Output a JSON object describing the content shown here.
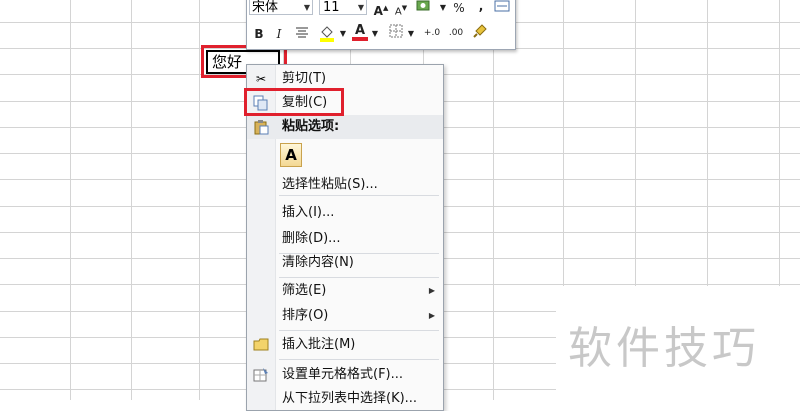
{
  "mini_toolbar": {
    "font_name": "宋体",
    "font_size": "11",
    "grow_font_glyph": "A",
    "shrink_font_glyph": "A",
    "percent_glyph": "%",
    "comma_glyph": ",",
    "bold_glyph": "B",
    "italic_glyph": "I",
    "font_color_glyph": "A",
    "increase_decimal_glyph": "+.0",
    "decrease_decimal_glyph": ".00"
  },
  "cell": {
    "value": "您好"
  },
  "context_menu": {
    "items": [
      {
        "label": "剪切(T)",
        "icon": "scissors-icon"
      },
      {
        "label": "复制(C)",
        "icon": "copy-icon"
      },
      {
        "label": "粘贴选项:",
        "icon": "paste-icon"
      },
      {
        "label": "选择性粘贴(S)..."
      },
      {
        "label": "插入(I)..."
      },
      {
        "label": "删除(D)..."
      },
      {
        "label": "清除内容(N)"
      },
      {
        "label": "筛选(E)",
        "submenu": true
      },
      {
        "label": "排序(O)",
        "submenu": true
      },
      {
        "label": "插入批注(M)",
        "icon": "comment-icon"
      },
      {
        "label": "设置单元格格式(F)...",
        "icon": "format-cells-icon"
      },
      {
        "label": "从下拉列表中选择(K)..."
      }
    ],
    "paste_option_glyph": "A"
  },
  "watermark": {
    "text": "软件技巧"
  },
  "colors": {
    "highlight_red": "#e0202d",
    "grid": "#d4d4d4",
    "font_color_bar": "#e0202d",
    "fill_color_bar": "#ffff00"
  }
}
